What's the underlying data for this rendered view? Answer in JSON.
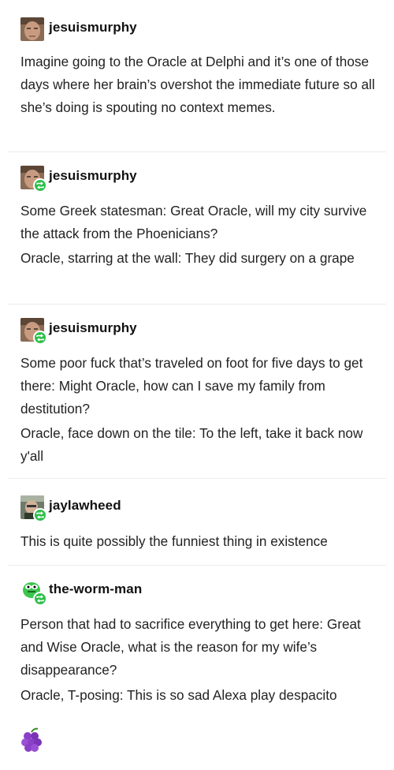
{
  "posts": [
    {
      "username": "jesuismurphy",
      "avatar": "man-face-avatar",
      "reblog": false,
      "paragraphs": [
        "Imagine going to the Oracle at Delphi and it’s one of those days where her brain’s overshot the immediate future so all she’s doing is spouting no context memes."
      ]
    },
    {
      "username": "jesuismurphy",
      "avatar": "man-face-avatar",
      "reblog": true,
      "paragraphs": [
        "Some Greek statesman: Great Oracle, will my city survive the attack from the Phoenicians?",
        "Oracle, starring at the wall: They did surgery on a grape"
      ]
    },
    {
      "username": "jesuismurphy",
      "avatar": "man-face-avatar",
      "reblog": true,
      "paragraphs": [
        "Some poor fuck that’s traveled on foot for five days to get there: Might Oracle, how can I save my family from destitution?",
        "Oracle, face down on the tile: To the left, take it back now y'all"
      ]
    },
    {
      "username": "jaylawheed",
      "avatar": "person-photo-avatar",
      "reblog": true,
      "paragraphs": [
        "This is quite possibly the funniest thing in existence"
      ]
    },
    {
      "username": "the-worm-man",
      "avatar": "green-worm-avatar",
      "reblog": true,
      "paragraphs": [
        "Person that had to sacrifice everything to get here: Great and Wise Oracle, what is the reason for my wife’s disappearance?",
        "Oracle, T-posing: This is so sad Alexa play despacito"
      ]
    }
  ],
  "footer_icon": "grapes-icon",
  "colors": {
    "reblog_badge": "#2fbf4c",
    "text": "#222222",
    "divider": "#ececec",
    "grape": "#8a3fc7"
  }
}
